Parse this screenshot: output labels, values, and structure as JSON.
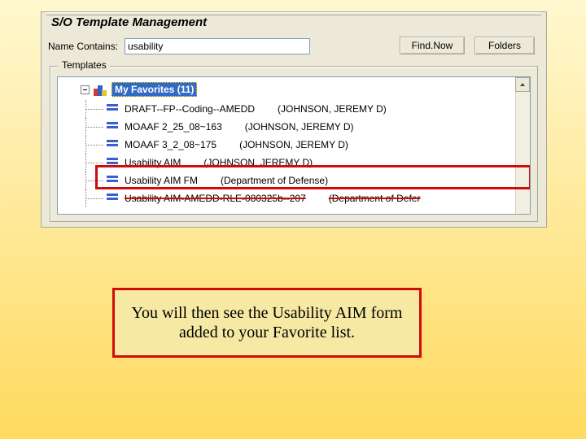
{
  "window": {
    "title": "S/O Template Management",
    "filter_label": "Name Contains:",
    "filter_value": "usability",
    "btn_find": "Find.Now",
    "btn_folders": "Folders",
    "group_legend": "Templates"
  },
  "tree": {
    "root_label": "My Favorites (11)",
    "items": [
      {
        "name": "DRAFT--FP--Coding--AMEDD",
        "owner": "(JOHNSON, JEREMY D)"
      },
      {
        "name": "MOAAF 2_25_08~163",
        "owner": "(JOHNSON, JEREMY D)"
      },
      {
        "name": "MOAAF 3_2_08~175",
        "owner": "(JOHNSON, JEREMY D)"
      },
      {
        "name": "Usability AIM",
        "owner": "(JOHNSON, JEREMY D)"
      },
      {
        "name": "Usability AIM FM",
        "owner": "(Department of Defense)"
      },
      {
        "name": "Usability AIM-AMEDD-RLE-080325b--207",
        "owner": "(Department of Defer"
      }
    ]
  },
  "callout": {
    "text": "You will then see the Usability AIM form added to your Favorite list."
  }
}
